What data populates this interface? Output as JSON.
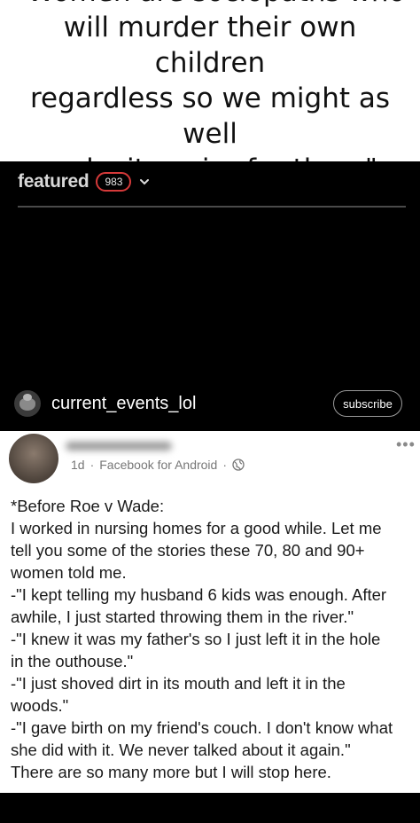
{
  "caption": {
    "lines": [
      "\"Women are sociopaths who",
      "will murder their own children",
      "regardless so we might as well",
      "make it easier for them\""
    ]
  },
  "video": {
    "featured_label": "featured",
    "count_badge": "983",
    "chevron_icon": "chevron-down-icon",
    "channel_name": "current_events_lol",
    "subscribe_label": "subscribe"
  },
  "post": {
    "time": "1d",
    "separator": "·",
    "source": "Facebook for Android",
    "globe_icon": "globe-icon",
    "more_icon": "more-dots-icon",
    "body_lines": [
      "*Before Roe v Wade:",
      "I worked in nursing homes for a good while. Let me",
      "tell you some of the stories these 70, 80 and 90+",
      "women told me.",
      "-\"I kept telling my husband 6 kids was enough. After",
      "awhile, I just started throwing them in the river.\"",
      "-\"I knew it was my father's so I just left it in the hole",
      "in the outhouse.\"",
      "-\"I just shoved dirt in its mouth and left it in the",
      "woods.\"",
      "-\"I gave birth on my friend's couch. I don't know what",
      "she did with it. We never talked about it again.\"",
      "There are so many more but I will stop here."
    ]
  },
  "colors": {
    "badge_border": "#d63a3a",
    "video_bg": "#000000",
    "meta_text": "#777777"
  }
}
